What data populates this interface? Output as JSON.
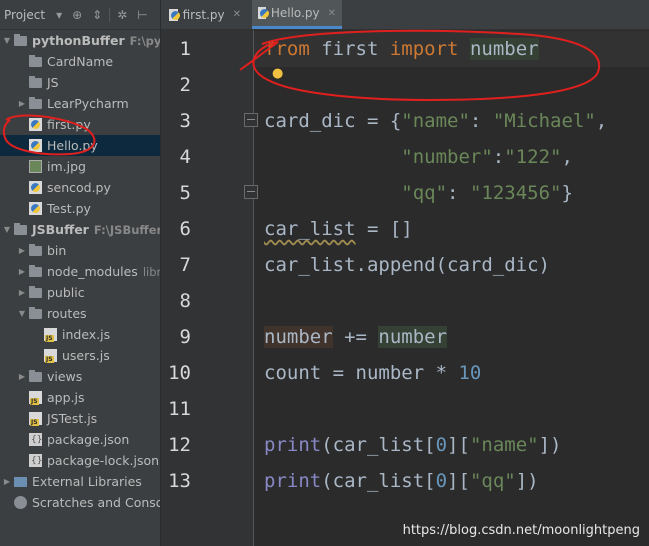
{
  "project_panel": {
    "title": "Project",
    "tree": [
      {
        "label": "pythonBuffer",
        "sub": "F:\\pythonB",
        "type": "folder",
        "depth": 0,
        "expanded": true,
        "bold": true
      },
      {
        "label": "CardName",
        "type": "folder",
        "depth": 1
      },
      {
        "label": "JS",
        "type": "folder",
        "depth": 1
      },
      {
        "label": "LearPycharm",
        "type": "folder",
        "depth": 1,
        "collapsed": true
      },
      {
        "label": "first.py",
        "type": "py",
        "depth": 1
      },
      {
        "label": "Hello.py",
        "type": "py",
        "depth": 1,
        "selected": true
      },
      {
        "label": "im.jpg",
        "type": "img",
        "depth": 1
      },
      {
        "label": "sencod.py",
        "type": "py",
        "depth": 1
      },
      {
        "label": "Test.py",
        "type": "py",
        "depth": 1
      },
      {
        "label": "JSBuffer",
        "sub": "F:\\JSBuffer",
        "type": "folder",
        "depth": 0,
        "expanded": true,
        "bold": true
      },
      {
        "label": "bin",
        "type": "folder",
        "depth": 1,
        "collapsed": true
      },
      {
        "label": "node_modules",
        "sub": "library",
        "type": "folder",
        "depth": 1,
        "collapsed": true
      },
      {
        "label": "public",
        "type": "folder",
        "depth": 1,
        "collapsed": true
      },
      {
        "label": "routes",
        "type": "folder",
        "depth": 1,
        "expanded": true
      },
      {
        "label": "index.js",
        "type": "js",
        "depth": 2
      },
      {
        "label": "users.js",
        "type": "js",
        "depth": 2
      },
      {
        "label": "views",
        "type": "folder",
        "depth": 1,
        "collapsed": true
      },
      {
        "label": "app.js",
        "type": "js",
        "depth": 1
      },
      {
        "label": "JSTest.js",
        "type": "js",
        "depth": 1
      },
      {
        "label": "package.json",
        "type": "json",
        "depth": 1
      },
      {
        "label": "package-lock.json",
        "type": "json",
        "depth": 1
      },
      {
        "label": "External Libraries",
        "type": "lib",
        "depth": 0,
        "collapsed": true
      },
      {
        "label": "Scratches and Consoles",
        "type": "scratch",
        "depth": 0
      }
    ]
  },
  "tabs": [
    {
      "label": "first.py",
      "active": false
    },
    {
      "label": "Hello.py",
      "active": true
    }
  ],
  "editor": {
    "line_numbers": [
      "1",
      "2",
      "3",
      "4",
      "5",
      "6",
      "7",
      "8",
      "9",
      "10",
      "11",
      "12",
      "13"
    ]
  },
  "watermark": "https://blog.csdn.net/moonlightpeng",
  "colors": {
    "annotation": "#e0201e",
    "keyword": "#cc7832",
    "string": "#6a8759",
    "number": "#6897bb",
    "builtin": "#8888c6"
  }
}
